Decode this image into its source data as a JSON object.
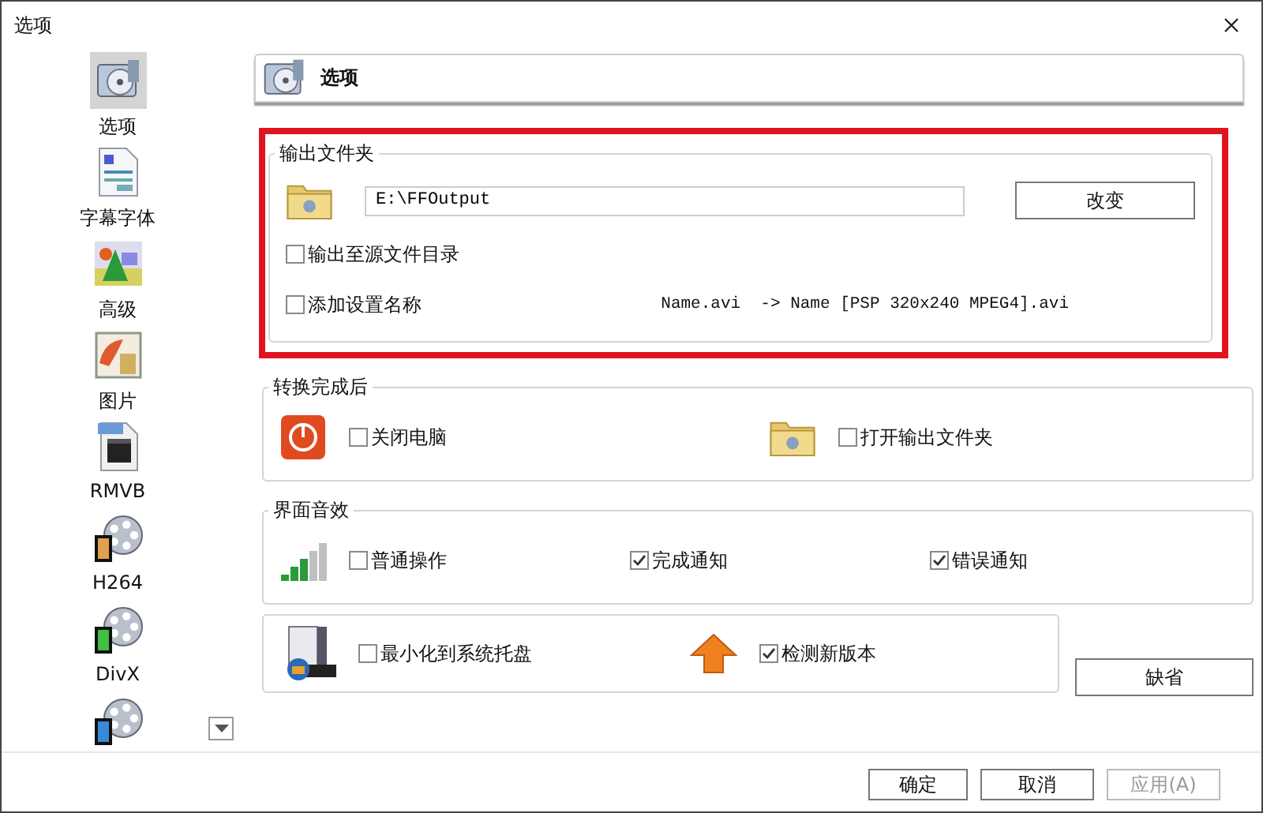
{
  "window": {
    "title": "选项"
  },
  "sidebar": {
    "items": [
      {
        "kind": "options",
        "label": "选项",
        "selected": true
      },
      {
        "kind": "subtitle",
        "label": "字幕字体",
        "selected": false
      },
      {
        "kind": "advanced",
        "label": "高级",
        "selected": false
      },
      {
        "kind": "picture",
        "label": "图片",
        "selected": false
      },
      {
        "kind": "rmvb",
        "label": "RMVB",
        "selected": false
      },
      {
        "kind": "film",
        "color": "#e0a050",
        "label": "H264",
        "selected": false
      },
      {
        "kind": "film",
        "color": "#40c040",
        "label": "DivX",
        "selected": false
      },
      {
        "kind": "film",
        "color": "#3a88d8",
        "selected": false
      }
    ]
  },
  "header": {
    "title": "选项"
  },
  "output_folder": {
    "legend": "输出文件夹",
    "path": "E:\\FFOutput",
    "change_button": "改变",
    "options": [
      {
        "label": "输出至源文件目录",
        "checked": false
      },
      {
        "label": "添加设置名称",
        "checked": false
      }
    ],
    "rename_example": "Name.avi  -> Name [PSP 320x240 MPEG4].avi"
  },
  "after_conversion": {
    "legend": "转换完成后",
    "items": [
      {
        "kind": "power",
        "label": "关闭电脑",
        "checked": false
      },
      {
        "kind": "folder",
        "label": "打开输出文件夹",
        "checked": false
      }
    ]
  },
  "sound": {
    "legend": "界面音效",
    "items": [
      {
        "label": "普通操作",
        "checked": false
      },
      {
        "label": "完成通知",
        "checked": true
      },
      {
        "label": "错误通知",
        "checked": true
      }
    ]
  },
  "misc": {
    "items": [
      {
        "kind": "tray",
        "label": "最小化到系统托盘",
        "checked": false
      },
      {
        "kind": "update",
        "label": "检测新版本",
        "checked": true
      }
    ]
  },
  "default_button": "缺省",
  "footer_buttons": [
    {
      "label": "确定",
      "disabled": false
    },
    {
      "label": "取消",
      "disabled": false
    },
    {
      "label": "应用(A)",
      "disabled": true
    }
  ]
}
